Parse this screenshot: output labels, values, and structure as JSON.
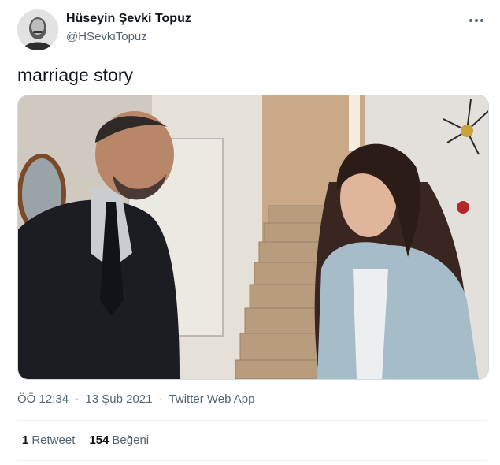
{
  "author": {
    "name": "Hüseyin Şevki Topuz",
    "handle": "@HSevkiTopuz",
    "avatar_icon": "user-avatar-photo"
  },
  "menu_icon": "more-horizontal-icon",
  "tweet": {
    "text": "marriage story",
    "media_description": "photo",
    "time": "ÖÖ 12:34",
    "separator": "·",
    "date": "13 Şub 2021",
    "source": "Twitter Web App"
  },
  "stats": {
    "retweets_count": "1",
    "retweets_label": "Retweet",
    "likes_count": "154",
    "likes_label": "Beğeni"
  },
  "colors": {
    "text_primary": "#0f1419",
    "text_secondary": "#536471",
    "divider": "#eff3f4"
  }
}
